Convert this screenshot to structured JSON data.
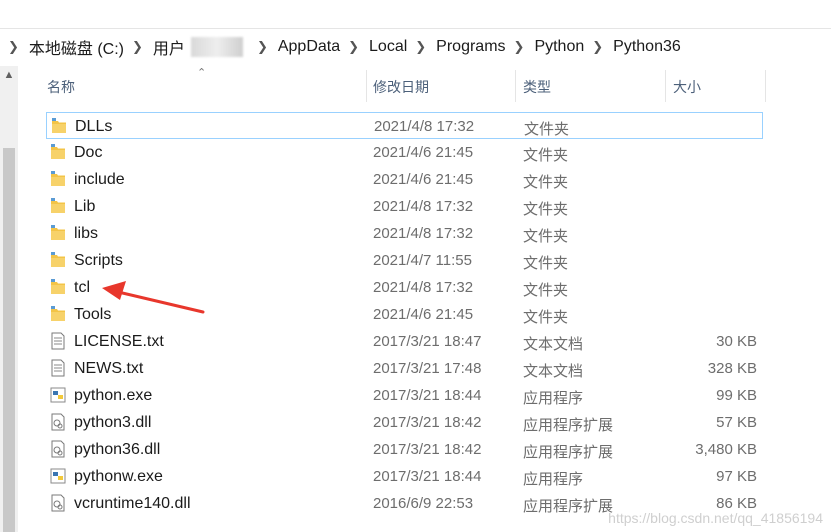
{
  "breadcrumb": {
    "items": [
      "本地磁盘 (C:)",
      "用户",
      "AppData",
      "Local",
      "Programs",
      "Python",
      "Python36"
    ]
  },
  "columns": {
    "name": "名称",
    "date": "修改日期",
    "type": "类型",
    "size": "大小"
  },
  "files": [
    {
      "name": "DLLs",
      "date": "2021/4/8 17:32",
      "type": "文件夹",
      "size": "",
      "icon": "folder-icon"
    },
    {
      "name": "Doc",
      "date": "2021/4/6 21:45",
      "type": "文件夹",
      "size": "",
      "icon": "folder-icon"
    },
    {
      "name": "include",
      "date": "2021/4/6 21:45",
      "type": "文件夹",
      "size": "",
      "icon": "folder-icon"
    },
    {
      "name": "Lib",
      "date": "2021/4/8 17:32",
      "type": "文件夹",
      "size": "",
      "icon": "folder-icon"
    },
    {
      "name": "libs",
      "date": "2021/4/8 17:32",
      "type": "文件夹",
      "size": "",
      "icon": "folder-icon"
    },
    {
      "name": "Scripts",
      "date": "2021/4/7 11:55",
      "type": "文件夹",
      "size": "",
      "icon": "folder-icon"
    },
    {
      "name": "tcl",
      "date": "2021/4/8 17:32",
      "type": "文件夹",
      "size": "",
      "icon": "folder-icon"
    },
    {
      "name": "Tools",
      "date": "2021/4/6 21:45",
      "type": "文件夹",
      "size": "",
      "icon": "folder-icon"
    },
    {
      "name": "LICENSE.txt",
      "date": "2017/3/21 18:47",
      "type": "文本文档",
      "size": "30 KB",
      "icon": "text-file-icon"
    },
    {
      "name": "NEWS.txt",
      "date": "2017/3/21 17:48",
      "type": "文本文档",
      "size": "328 KB",
      "icon": "text-file-icon"
    },
    {
      "name": "python.exe",
      "date": "2017/3/21 18:44",
      "type": "应用程序",
      "size": "99 KB",
      "icon": "python-exe-icon"
    },
    {
      "name": "python3.dll",
      "date": "2017/3/21 18:42",
      "type": "应用程序扩展",
      "size": "57 KB",
      "icon": "dll-icon"
    },
    {
      "name": "python36.dll",
      "date": "2017/3/21 18:42",
      "type": "应用程序扩展",
      "size": "3,480 KB",
      "icon": "dll-icon"
    },
    {
      "name": "pythonw.exe",
      "date": "2017/3/21 18:44",
      "type": "应用程序",
      "size": "97 KB",
      "icon": "python-exe-icon"
    },
    {
      "name": "vcruntime140.dll",
      "date": "2016/6/9 22:53",
      "type": "应用程序扩展",
      "size": "86 KB",
      "icon": "dll-icon"
    }
  ],
  "selected_index": 0,
  "watermark": "https://blog.csdn.net/qq_41856194",
  "colors": {
    "folder": "#f3c447",
    "selection_border": "#99d1ff",
    "header_text": "#4c607a",
    "arrow": "#e8372c"
  }
}
